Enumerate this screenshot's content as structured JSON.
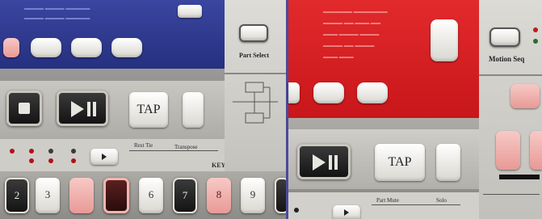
{
  "labels": {
    "part_select": "Part Select",
    "motion_seq": "Motion Seq",
    "tap_left": "TAP",
    "tap_right": "TAP",
    "rest_tie": "Rest Tie",
    "transpose": "Transpose",
    "keyboard": "KEYBOARD",
    "part_mute": "Part Mute",
    "solo": "Solo",
    "pad_numbers": [
      "2",
      "3",
      "",
      "",
      "6",
      "7",
      "8",
      "9"
    ]
  },
  "colors": {
    "left_display": "#2f3a8c",
    "right_display": "#d81e22",
    "panel_grey": "#d7d5d0",
    "button_pink": "#f0aeaa"
  },
  "icons": {
    "play_pause": "play-pause-icon",
    "stop": "stop-icon",
    "right_arrow": "right-arrow-icon"
  }
}
